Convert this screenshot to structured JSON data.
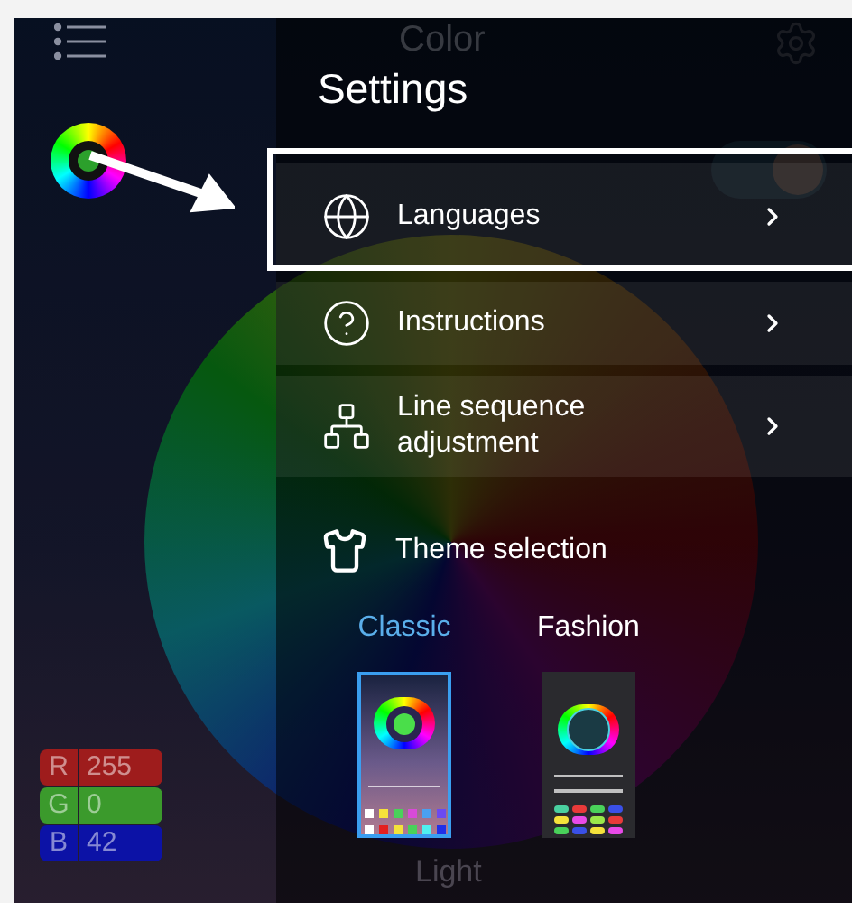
{
  "background": {
    "title": "Color",
    "rgb": [
      {
        "channel": "R",
        "value": "255",
        "color": "#9e1c1c"
      },
      {
        "channel": "G",
        "value": "0",
        "color": "#3b9a2c"
      },
      {
        "channel": "B",
        "value": "42",
        "color": "#0c12a6"
      }
    ],
    "bottom_label": "Light",
    "power_on": true
  },
  "settings": {
    "title": "Settings",
    "items": [
      {
        "kind": "link",
        "label": "Languages"
      },
      {
        "kind": "link",
        "label": "Instructions"
      },
      {
        "kind": "link",
        "label": "Line sequence adjustment"
      },
      {
        "kind": "heading",
        "label": "Theme selection"
      }
    ],
    "themes": [
      {
        "label": "Classic",
        "selected": true
      },
      {
        "label": "Fashion",
        "selected": false
      }
    ]
  }
}
